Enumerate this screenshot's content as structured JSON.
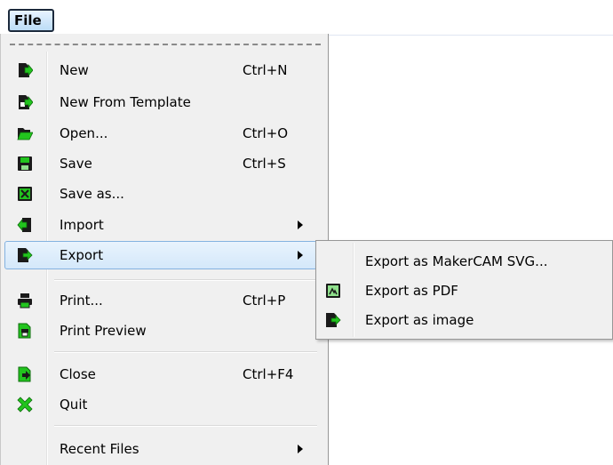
{
  "menubar": {
    "file_label": "File"
  },
  "file_menu": {
    "items": [
      {
        "label": "New",
        "accel": "Ctrl+N",
        "icon": "new-document-icon"
      },
      {
        "label": "New From Template",
        "accel": "",
        "icon": "new-from-template-icon"
      },
      {
        "label": "Open...",
        "accel": "Ctrl+O",
        "icon": "open-folder-icon"
      },
      {
        "label": "Save",
        "accel": "Ctrl+S",
        "icon": "floppy-disk-icon"
      },
      {
        "label": "Save as...",
        "accel": "",
        "icon": "save-as-icon"
      },
      {
        "label": "Import",
        "accel": "",
        "icon": "import-icon",
        "submenu": true
      },
      {
        "label": "Export",
        "accel": "",
        "icon": "export-icon",
        "submenu": true,
        "active": true
      },
      {
        "label": "Print...",
        "accel": "Ctrl+P",
        "icon": "printer-icon"
      },
      {
        "label": "Print Preview",
        "accel": "",
        "icon": "print-preview-icon"
      },
      {
        "label": "Close",
        "accel": "Ctrl+F4",
        "icon": "close-document-icon"
      },
      {
        "label": "Quit",
        "accel": "",
        "icon": "quit-icon"
      },
      {
        "label": "Recent Files",
        "accel": "",
        "icon": "",
        "submenu": true
      }
    ]
  },
  "export_submenu": {
    "items": [
      {
        "label": "Export as MakerCAM SVG...",
        "icon": ""
      },
      {
        "label": "Export as PDF",
        "icon": "pdf-icon"
      },
      {
        "label": "Export as image",
        "icon": "export-image-icon"
      }
    ]
  },
  "colors": {
    "icon_green": "#22c41e",
    "icon_dark": "#1a1a1a",
    "highlight_border": "#84b2e0"
  }
}
